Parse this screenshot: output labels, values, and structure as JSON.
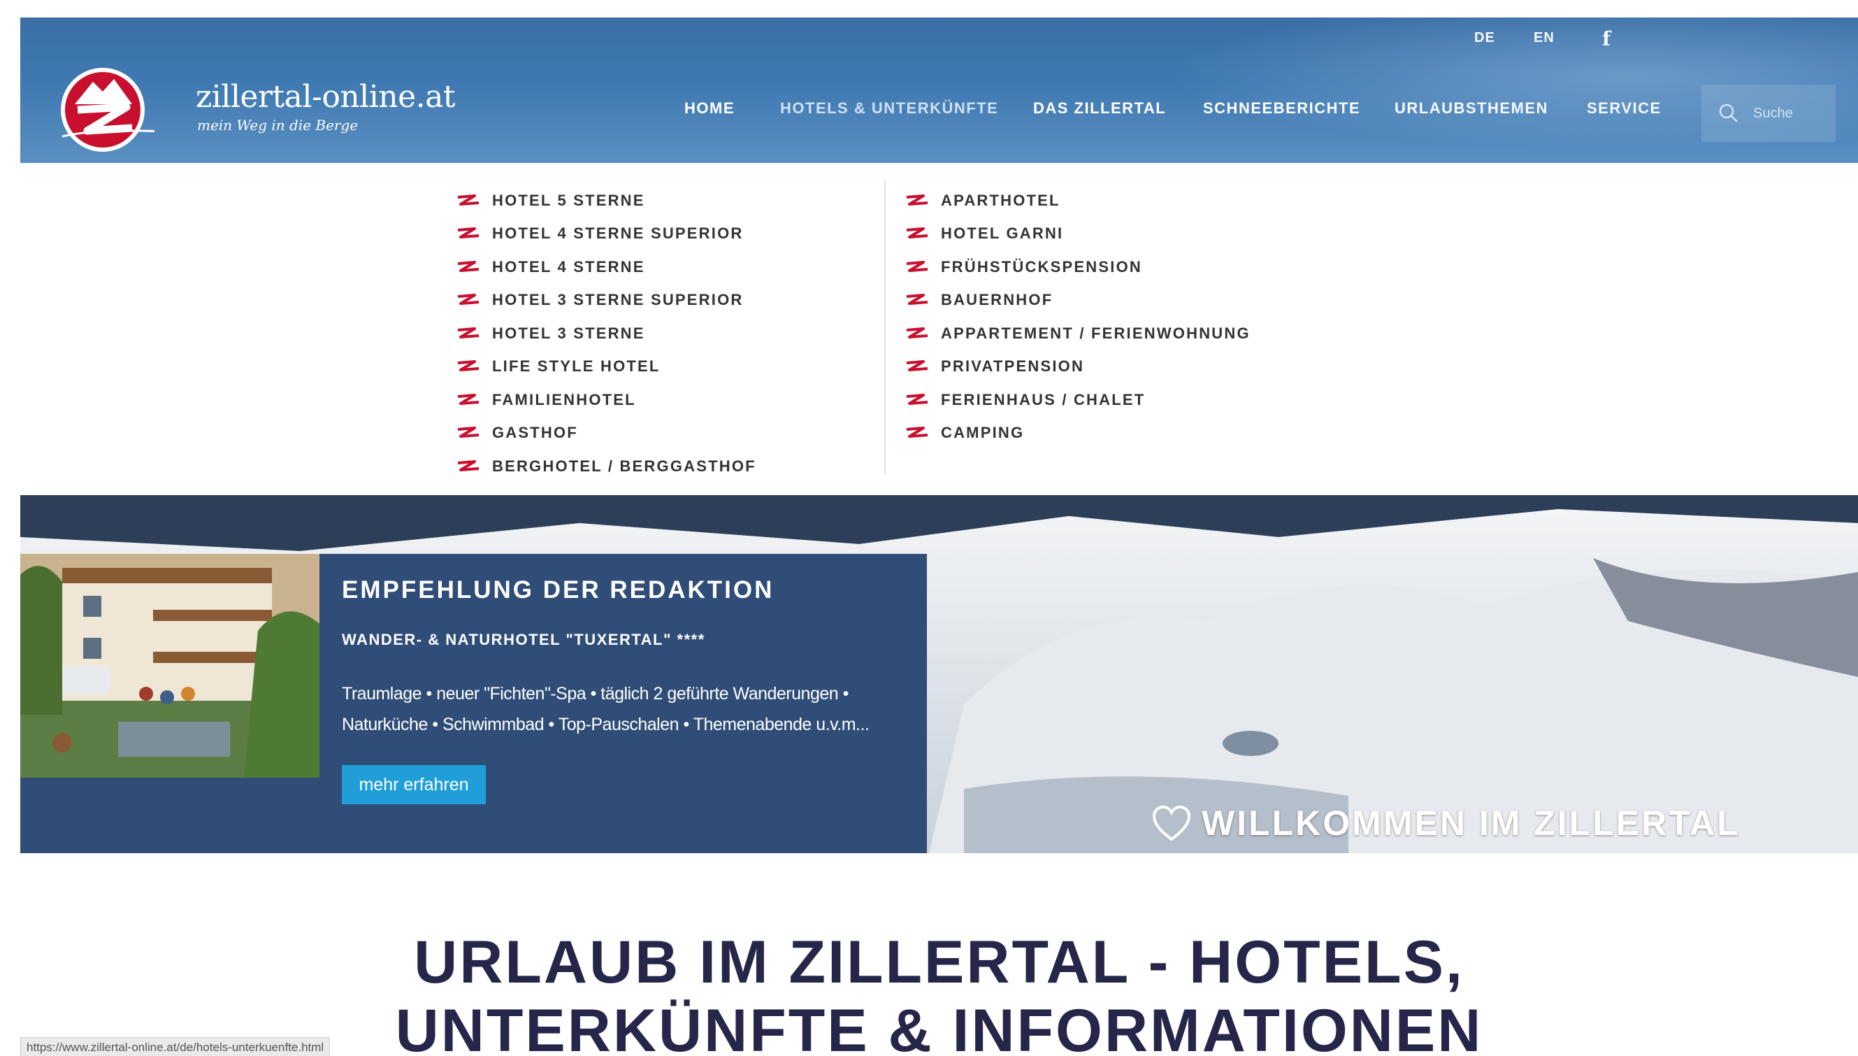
{
  "header": {
    "logo_text": "zillertal-online.at",
    "logo_tagline": "mein Weg in die Berge",
    "languages": [
      "DE",
      "EN"
    ],
    "social_icon": "facebook-icon",
    "nav": [
      "HOME",
      "HOTELS & UNTERKÜNFTE",
      "DAS ZILLERTAL",
      "SCHNEEBERICHTE",
      "URLAUBSTHEMEN",
      "SERVICE"
    ],
    "search_placeholder": "Suche"
  },
  "dropdown": {
    "left_column": [
      "HOTEL 5 STERNE",
      "HOTEL 4 STERNE SUPERIOR",
      "HOTEL 4 STERNE",
      "HOTEL 3 STERNE SUPERIOR",
      "HOTEL 3 STERNE",
      "LIFE STYLE HOTEL",
      "FAMILIENHOTEL",
      "GASTHOF",
      "BERGHOTEL / BERGGASTHOF"
    ],
    "right_column": [
      "APARTHOTEL",
      "HOTEL GARNI",
      "FRÜHSTÜCKSPENSION",
      "BAUERNHOF",
      "APPARTEMENT / FERIENWOHNUNG",
      "PRIVATPENSION",
      "FERIENHAUS / CHALET",
      "CAMPING"
    ]
  },
  "promo": {
    "title": "EMPFEHLUNG DER REDAKTION",
    "hotel": "WANDER- & NATURHOTEL \"TUXERTAL\" ****",
    "text_line1": "Traumlage • neuer \"Fichten\"-Spa • täglich 2 geführte Wanderungen •",
    "text_line2": "Naturküche • Schwimmbad • Top-Pauschalen • Themenabende u.v.m...",
    "button": "mehr erfahren"
  },
  "hero": {
    "welcome": "WILLKOMMEN IM ZILLERTAL"
  },
  "main": {
    "title_line1": "URLAUB IM ZILLERTAL - HOTELS,",
    "title_line2": "UNTERKÜNFTE & INFORMATIONEN"
  },
  "status_bar_url": "https://www.zillertal-online.at/de/hotels-unterkuenfte.html",
  "colors": {
    "header_blue": "#3f79b2",
    "promo_blue": "#2f4d77",
    "button_blue": "#1f9ed9",
    "logo_red": "#c8102e",
    "heading_navy": "#26264a"
  }
}
